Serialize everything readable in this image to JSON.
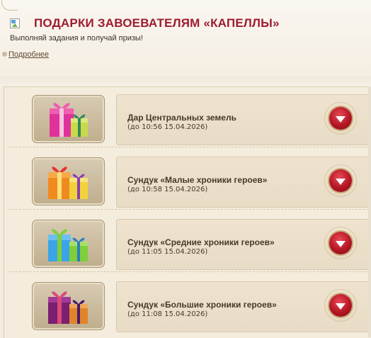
{
  "header": {
    "title": "ПОДАРКИ ЗАВОЕВАТЕЛЯМ «КАПЕЛЛЫ»",
    "subtitle": "Выполняй задания и получай призы!",
    "more_link": "Подробнее"
  },
  "items": [
    {
      "name": "Дар Центральных земель",
      "date": "(до 10:56 15.04.2026)",
      "gift_colors": [
        "#e0329b",
        "#c9d94a"
      ]
    },
    {
      "name": "Сундук «Малые хроники героев»",
      "date": "(до 10:58 15.04.2026)",
      "gift_colors": [
        "#f08a1e",
        "#f2d23a"
      ]
    },
    {
      "name": "Сундук «Средние хроники героев»",
      "date": "(до 11:05 15.04.2026)",
      "gift_colors": [
        "#3ba4e6",
        "#7fcf3a"
      ]
    },
    {
      "name": "Сундук «Большие хроники героев»",
      "date": "(до 11:08 15.04.2026)",
      "gift_colors": [
        "#7b1f6e",
        "#e0842b"
      ]
    }
  ],
  "colors": {
    "title": "#9e1b2f",
    "button": "#b51624"
  }
}
